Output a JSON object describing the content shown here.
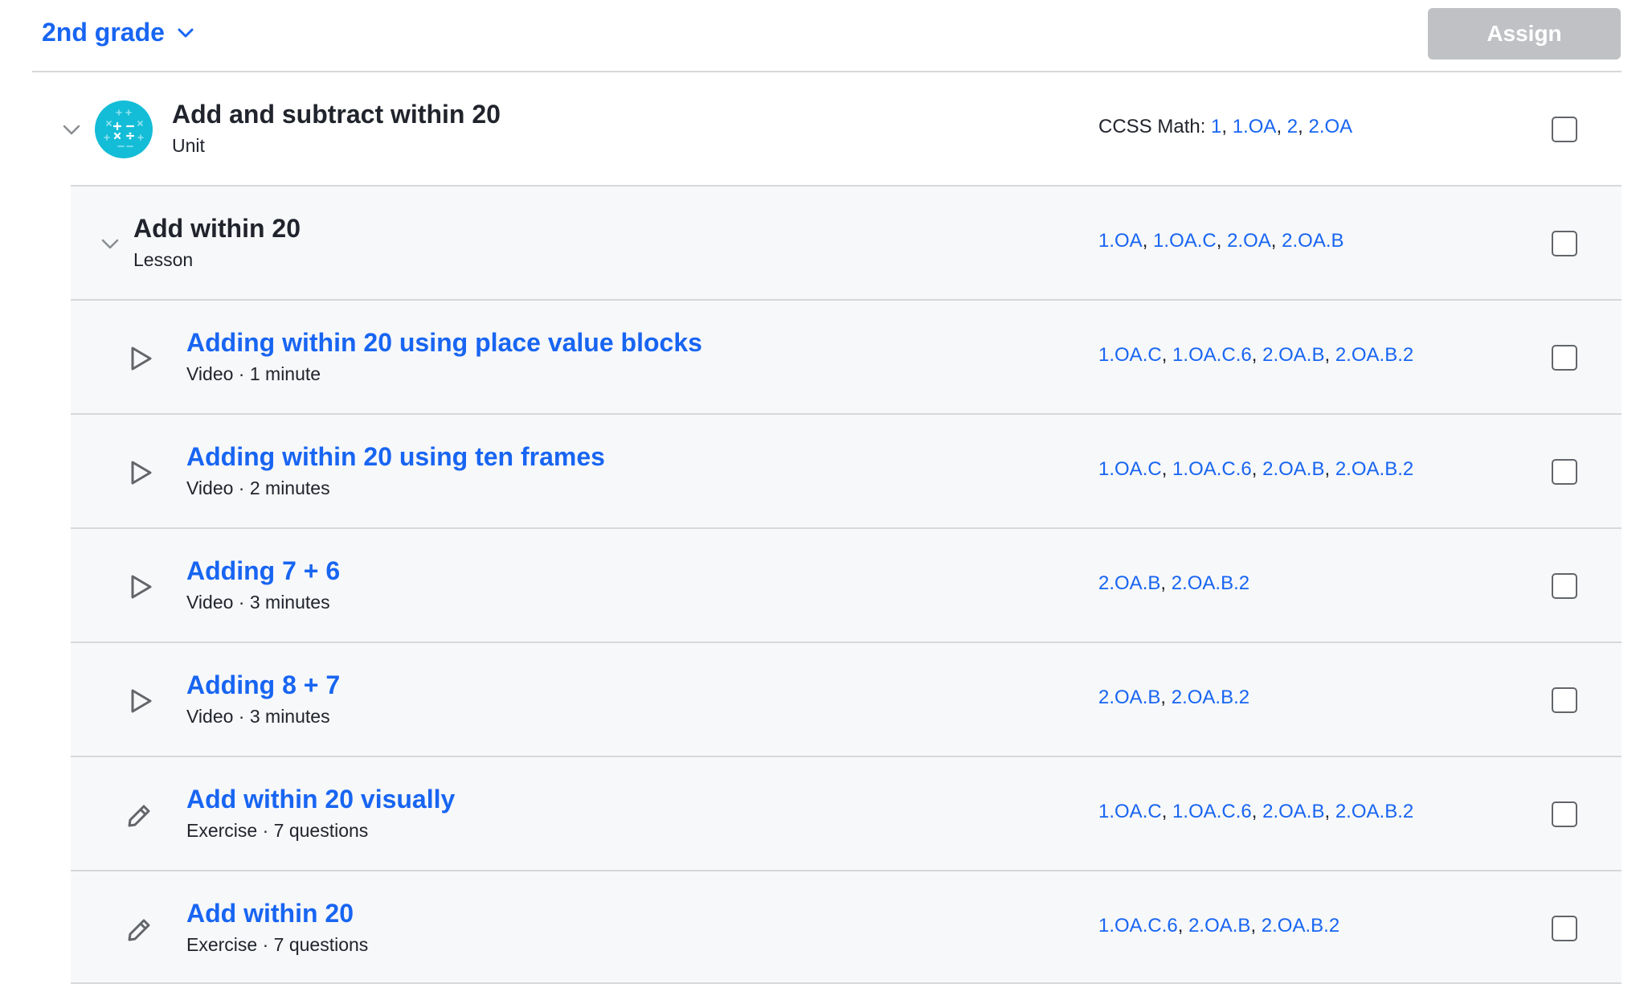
{
  "header": {
    "grade_label": "2nd grade",
    "assign_label": "Assign"
  },
  "unit": {
    "title": "Add and subtract within 20",
    "type": "Unit",
    "standards_prefix": "CCSS Math:",
    "standards": [
      "1",
      "1.OA",
      "2",
      "2.OA"
    ]
  },
  "lesson": {
    "title": "Add within 20",
    "type": "Lesson",
    "standards": [
      "1.OA",
      "1.OA.C",
      "2.OA",
      "2.OA.B"
    ]
  },
  "items": [
    {
      "icon": "play-icon",
      "title": "Adding within 20 using place value blocks",
      "subtitle": "Video · 1 minute",
      "standards": [
        "1.OA.C",
        "1.OA.C.6",
        "2.OA.B",
        "2.OA.B.2"
      ]
    },
    {
      "icon": "play-icon",
      "title": "Adding within 20 using ten frames",
      "subtitle": "Video · 2 minutes",
      "standards": [
        "1.OA.C",
        "1.OA.C.6",
        "2.OA.B",
        "2.OA.B.2"
      ]
    },
    {
      "icon": "play-icon",
      "title": "Adding 7 + 6",
      "subtitle": "Video · 3 minutes",
      "standards": [
        "2.OA.B",
        "2.OA.B.2"
      ]
    },
    {
      "icon": "play-icon",
      "title": "Adding 8 + 7",
      "subtitle": "Video · 3 minutes",
      "standards": [
        "2.OA.B",
        "2.OA.B.2"
      ]
    },
    {
      "icon": "pencil-icon",
      "title": "Add within 20 visually",
      "subtitle": "Exercise · 7 questions",
      "standards": [
        "1.OA.C",
        "1.OA.C.6",
        "2.OA.B",
        "2.OA.B.2"
      ]
    },
    {
      "icon": "pencil-icon",
      "title": "Add within 20",
      "subtitle": "Exercise · 7 questions",
      "standards": [
        "1.OA.C.6",
        "2.OA.B",
        "2.OA.B.2"
      ]
    }
  ],
  "colors": {
    "link": "#1865f2",
    "text": "#21242c",
    "unit_icon_bg": "#14bdd7",
    "disabled_button": "#bfc1c4",
    "row_bg": "#f7f8fa",
    "divider": "#d6d8da"
  }
}
